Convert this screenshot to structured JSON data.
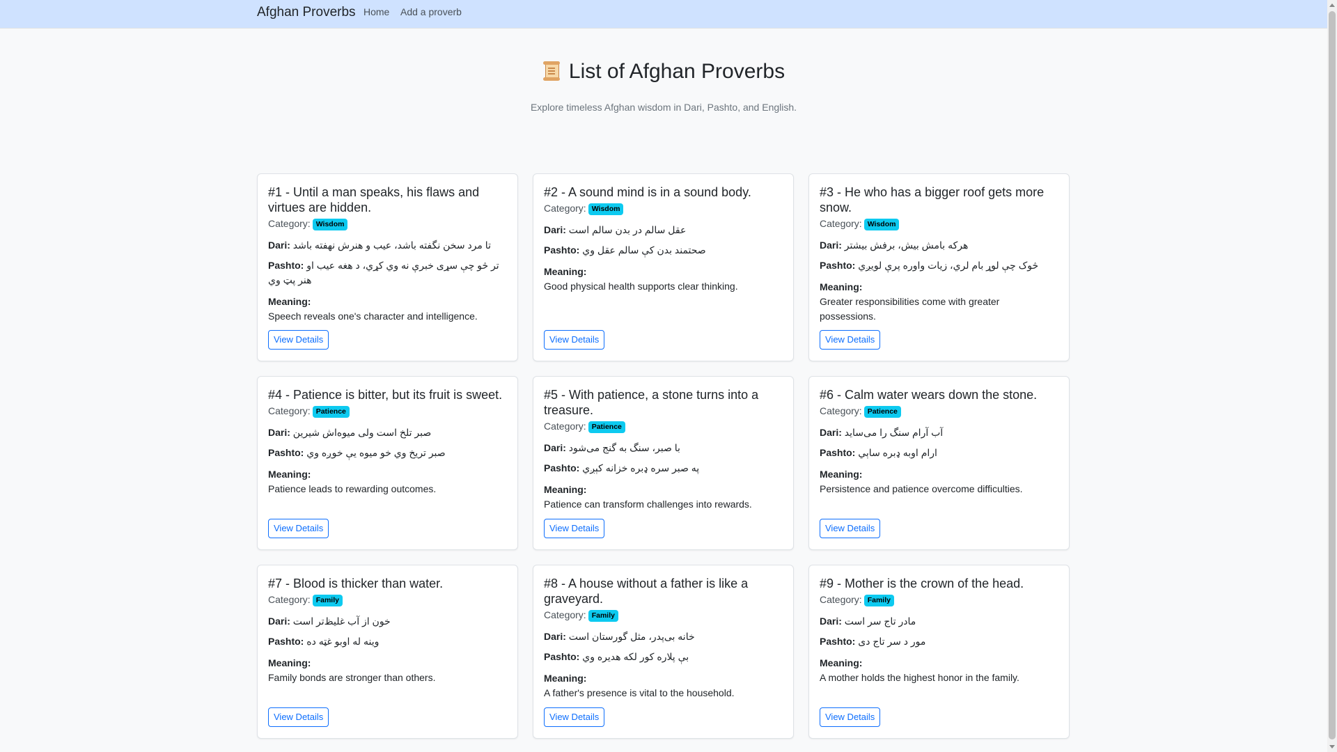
{
  "navbar": {
    "brand": "Afghan Proverbs",
    "links": [
      "Home",
      "Add a proverb"
    ]
  },
  "header": {
    "title": "List of Afghan Proverbs",
    "subtitle": "Explore timeless Afghan wisdom in Dari, Pashto, and English."
  },
  "labels": {
    "category": "Category:",
    "dari": "Dari:",
    "pashto": "Pashto:",
    "meaning": "Meaning:",
    "view_details": "View Details"
  },
  "proverbs": [
    {
      "title": "#1 - Until a man speaks, his flaws and virtues are hidden.",
      "category": "Wisdom",
      "dari": "تا مرد سخن نگفته باشد، عیب و هنرش نهفته باشد",
      "pashto": "تر څو چې سړی خبرې نه وي کړي، د هغه عیب او هنر پټ وي",
      "meaning": "Speech reveals one's character and intelligence."
    },
    {
      "title": "#2 - A sound mind is in a sound body.",
      "category": "Wisdom",
      "dari": "عقل سالم در بدن سالم است",
      "pashto": "صحتمند بدن کې سالم عقل وي",
      "meaning": "Good physical health supports clear thinking."
    },
    {
      "title": "#3 - He who has a bigger roof gets more snow.",
      "category": "Wisdom",
      "dari": "هرکه بامش بیش، برفش بیشتر",
      "pashto": "څوک چې لوړ بام لري، زيات واوره پرې لويږي",
      "meaning": "Greater responsibilities come with greater possessions."
    },
    {
      "title": "#4 - Patience is bitter, but its fruit is sweet.",
      "category": "Patience",
      "dari": "صبر تلخ است ولی میوه‌اش شیرین",
      "pashto": "صبر تریخ وي خو میوه یې خوږه وي",
      "meaning": "Patience leads to rewarding outcomes."
    },
    {
      "title": "#5 - With patience, a stone turns into a treasure.",
      "category": "Patience",
      "dari": "با صبر، سنگ به گنج می‌شود",
      "pashto": "په صبر سره ډبره خزانه کېږي",
      "meaning": "Patience can transform challenges into rewards."
    },
    {
      "title": "#6 - Calm water wears down the stone.",
      "category": "Patience",
      "dari": "آب آرام سنگ را می‌ساید",
      "pashto": "ارام اوبه ډبره ساېي",
      "meaning": "Persistence and patience overcome difficulties."
    },
    {
      "title": "#7 - Blood is thicker than water.",
      "category": "Family",
      "dari": "خون از آب غلیظ‌تر است",
      "pashto": "وینه له اوبو غټه ده",
      "meaning": "Family bonds are stronger than others."
    },
    {
      "title": "#8 - A house without a father is like a graveyard.",
      "category": "Family",
      "dari": "خانه بی‌پدر، مثل گورستان است",
      "pashto": "بې پلاره کور لکه هدیره وي",
      "meaning": "A father's presence is vital to the household."
    },
    {
      "title": "#9 - Mother is the crown of the head.",
      "category": "Family",
      "dari": "مادر تاج سر است",
      "pashto": "مور د سر تاج دی",
      "meaning": "A mother holds the highest honor in the family."
    }
  ],
  "colors": {
    "navbar_bg": "#cfe2ff",
    "badge_bg": "#0dcaf0",
    "button_accent": "#0d6efd",
    "page_bg": "#f8f9fa"
  },
  "icons": {
    "title_icon": "scroll-icon"
  }
}
